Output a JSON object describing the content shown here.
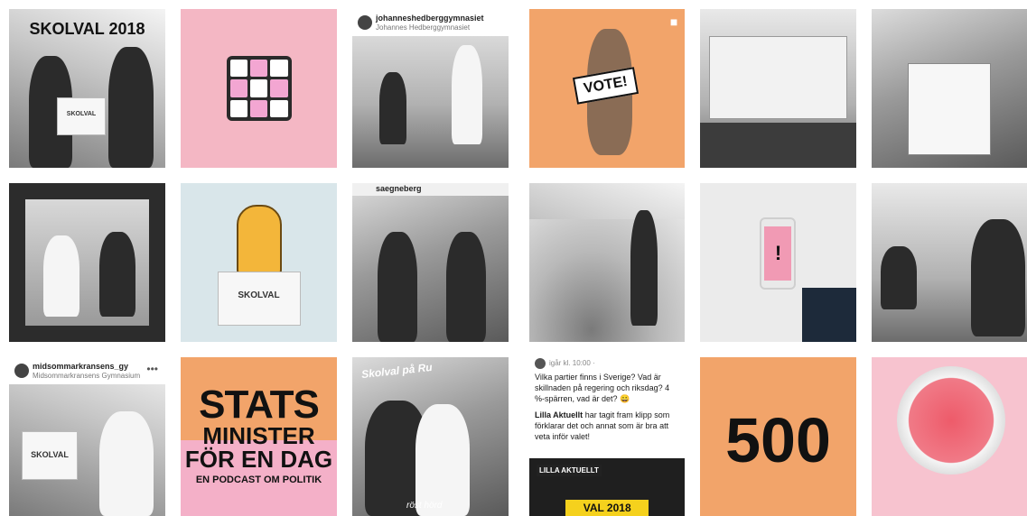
{
  "left_grid": {
    "tiles": [
      {
        "title": "SKOLVAL 2018",
        "box_label": "SKOLVAL"
      },
      {},
      {
        "username": "johanneshedberggymnasiet",
        "subtitle": "Johannes Hedberggymnasiet"
      },
      {},
      {
        "box_label": "SKOLVAL"
      },
      {
        "username": "saegneberg"
      },
      {
        "username": "midsommarkransens_gy",
        "subtitle": "Midsommarkransens Gymnasium",
        "box_label": "SKOLVAL"
      },
      {
        "line1": "STATS",
        "line2": "MINISTER",
        "line3": "FÖR EN DAG",
        "line4": "EN PODCAST OM POLITIK"
      },
      {
        "overlay": "Skolval på Ru",
        "bottom_text": "röst hörd"
      }
    ]
  },
  "right_grid": {
    "tiles": [
      {
        "sticker": "VOTE!",
        "icon": "video-icon"
      },
      {},
      {},
      {},
      {
        "phone_symbol": "!"
      },
      {},
      {
        "meta": "igår kl. 10:00 · ",
        "post_text_1": "Vilka partier finns i Sverige? Vad är skillnaden på regering och riksdag? 4 %-spärren, vad är det? 😀",
        "post_text_2_bold": "Lilla Aktuellt",
        "post_text_2_rest": " har tagit fram klipp som förklarar det och annat som är bra att veta inför valet!",
        "badge": "LILLA AKTUELLT",
        "banner": "VAL 2018"
      },
      {
        "number": "500"
      },
      {}
    ]
  },
  "colors": {
    "orange": "#f2a46a",
    "pink": "#f4b7c4",
    "yellow": "#f5d11d"
  }
}
